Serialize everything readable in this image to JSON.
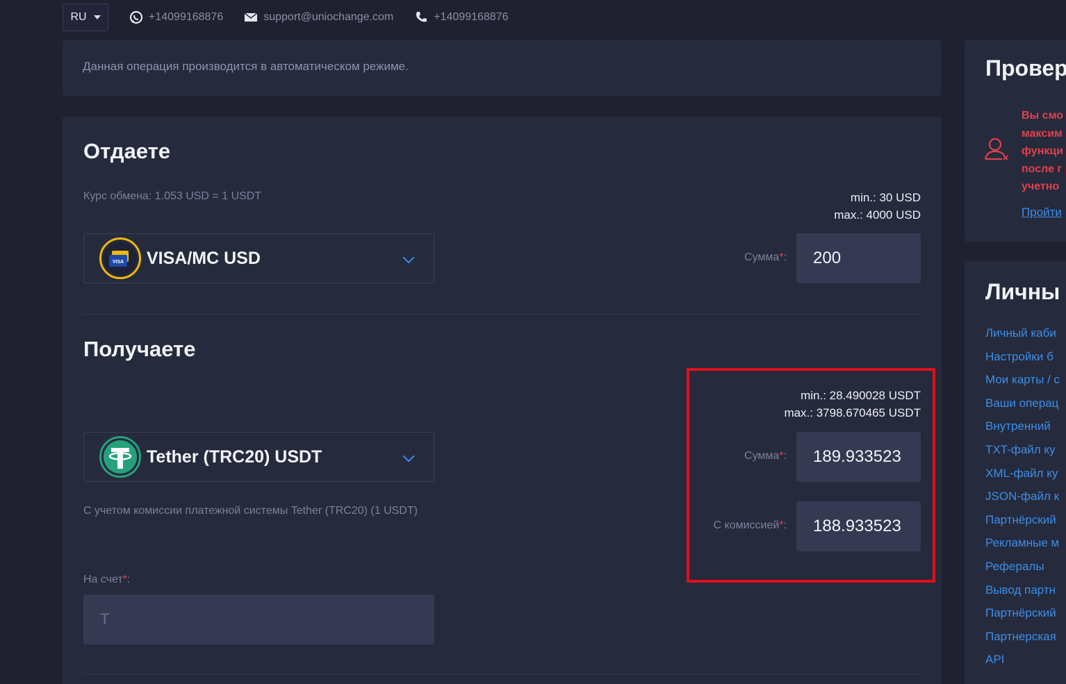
{
  "topbar": {
    "lang": "RU",
    "whatsapp": "+14099168876",
    "email": "support@uniochange.com",
    "phone": "+14099168876"
  },
  "info": "Данная операция производится в автоматическом режиме.",
  "give": {
    "title": "Отдаете",
    "rate": "Курс обмена: 1.053 USD = 1 USDT",
    "min": "min.: 30 USD",
    "max": "max.: 4000 USD",
    "currency": "VISA/MC USD",
    "amount_label": "Сумма",
    "amount": "200"
  },
  "get": {
    "title": "Получаете",
    "min": "min.: 28.490028 USDT",
    "max": "max.: 3798.670465 USDT",
    "currency": "Tether (TRC20) USDT",
    "amount_label": "Сумма",
    "amount": "189.933523",
    "fee_label": "С комиссией",
    "fee_amount": "188.933523",
    "fee_note": "С учетом комиссии платежной системы Tether (TRC20) (1 USDT)",
    "account_label": "На счет",
    "account_value": "T"
  },
  "sidebar": {
    "check_title": "Провер",
    "warning_lines": [
      "Вы смо",
      "максим",
      "функци",
      "после г",
      "учетно"
    ],
    "warning_link": "Пройти",
    "account_title": "Личны",
    "links": [
      "Личный каби",
      "Настройки б",
      "Мои карты / с",
      "Ваши операц",
      "Внутренний",
      "TXT-файл ку",
      "XML-файл ку",
      "JSON-файл к",
      "Партнёрский",
      "Рекламные м",
      "Рефералы",
      "Вывод партн",
      "Партнёрский",
      "Партнерская",
      "API"
    ]
  },
  "colors": {
    "accent": "#3b8ee8",
    "danger": "#e0414a",
    "highlight": "#e0101a",
    "tether": "#26a17b",
    "visa_ring": "#f0b90b"
  }
}
